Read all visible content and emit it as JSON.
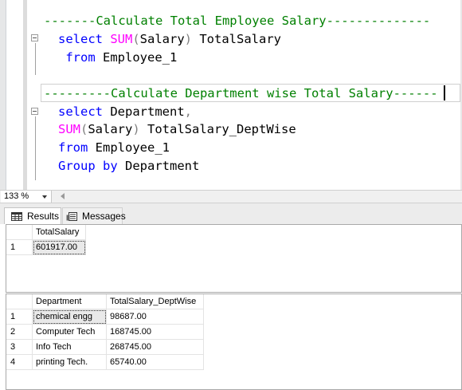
{
  "editor": {
    "lines": [
      [
        {
          "t": "-------Calculate Total Employee Salary--------------",
          "c": "cm"
        }
      ],
      [
        {
          "t": "select ",
          "c": "kw"
        },
        {
          "t": "SUM",
          "c": "fn"
        },
        {
          "t": "(",
          "c": "op"
        },
        {
          "t": "Salary",
          "c": "id"
        },
        {
          "t": ")",
          "c": "op"
        },
        {
          "t": " TotalSalary",
          "c": "id"
        }
      ],
      [
        {
          "t": " from ",
          "c": "kw"
        },
        {
          "t": "Employee_1",
          "c": "id"
        }
      ],
      [],
      [
        {
          "t": "---------Calculate Department wise Total Salary------",
          "c": "cm"
        }
      ],
      [
        {
          "t": "select ",
          "c": "kw"
        },
        {
          "t": "Department",
          "c": "id"
        },
        {
          "t": ",",
          "c": "op"
        }
      ],
      [
        {
          "t": "SUM",
          "c": "fn"
        },
        {
          "t": "(",
          "c": "op"
        },
        {
          "t": "Salary",
          "c": "id"
        },
        {
          "t": ")",
          "c": "op"
        },
        {
          "t": " TotalSalary_DeptWise",
          "c": "id"
        }
      ],
      [
        {
          "t": "from ",
          "c": "kw"
        },
        {
          "t": "Employee_1",
          "c": "id"
        }
      ],
      [
        {
          "t": "Group by ",
          "c": "kw"
        },
        {
          "t": "Department",
          "c": "id"
        }
      ]
    ]
  },
  "zoom": {
    "value": "133 %"
  },
  "tabs": {
    "results": "Results",
    "messages": "Messages"
  },
  "result1": {
    "headers": [
      "TotalSalary"
    ],
    "rows": [
      {
        "n": "1",
        "cells": [
          "601917.00"
        ]
      }
    ]
  },
  "result2": {
    "headers": [
      "Department",
      "TotalSalary_DeptWise"
    ],
    "rows": [
      {
        "n": "1",
        "cells": [
          "chemical engg",
          "98687.00"
        ]
      },
      {
        "n": "2",
        "cells": [
          "Computer Tech",
          "168745.00"
        ]
      },
      {
        "n": "3",
        "cells": [
          "Info Tech",
          "268745.00"
        ]
      },
      {
        "n": "4",
        "cells": [
          "printing Tech.",
          "65740.00"
        ]
      }
    ]
  }
}
